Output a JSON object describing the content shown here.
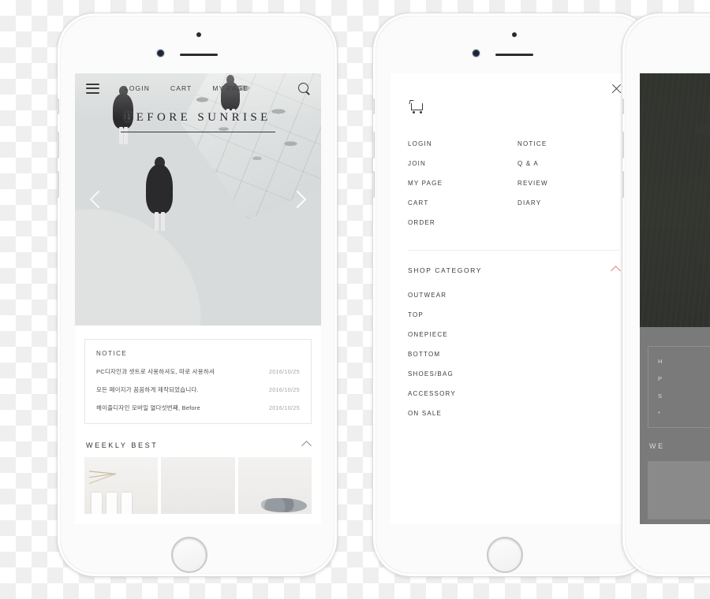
{
  "scene": {
    "background": "transparency-checkerboard",
    "checker_colors": [
      "#ffffff",
      "#efefef"
    ]
  },
  "phone_left": {
    "device": "white smartphone",
    "screen": {
      "topbar": {
        "menu_icon": "hamburger-icon",
        "nav": [
          {
            "label": "LOGIN"
          },
          {
            "label": "CART"
          },
          {
            "label": "MY PAGE"
          }
        ],
        "search_icon": "search-icon"
      },
      "hero": {
        "title": "BEFORE SUNRISE",
        "prev_arrow": "chevron-left-icon",
        "next_arrow": "chevron-right-icon",
        "image_alt": "women on curved concrete staircase, greyscale"
      },
      "notice": {
        "label": "NOTICE",
        "rows": [
          {
            "text": "PC디자인과 셋트로 사용하셔도, 따로 사용하셔",
            "date": "2016/10/25"
          },
          {
            "text": "모든 페이지가 꼼꼼하게 제작되었습니다.",
            "date": "2016/10/25"
          },
          {
            "text": "헤이즐디자인 모바일 열다섯번째, Before",
            "date": "2016/10/25"
          }
        ]
      },
      "weekly_best": {
        "title": "WEEKLY BEST",
        "collapse_icon": "chevron-up-icon",
        "thumbnails": [
          {
            "alt": "cosmetic tubes with dried pampas"
          },
          {
            "alt": "plain light product"
          },
          {
            "alt": "dark marbled fabric"
          }
        ]
      }
    }
  },
  "phone_center": {
    "device": "white smartphone",
    "screen": {
      "close_icon": "close-icon",
      "cart_icon": "shopping-cart-icon",
      "menu_columns": [
        {
          "items": [
            {
              "label": "LOGIN"
            },
            {
              "label": "JOIN"
            },
            {
              "label": "MY PAGE"
            },
            {
              "label": "CART"
            },
            {
              "label": "ORDER"
            }
          ]
        },
        {
          "items": [
            {
              "label": "NOTICE"
            },
            {
              "label": "Q & A"
            },
            {
              "label": "REVIEW"
            },
            {
              "label": "DIARY"
            }
          ]
        }
      ],
      "shop_category": {
        "title": "SHOP CATEGORY",
        "toggle_icon": "chevron-up-icon",
        "toggle_color": "#e4818b",
        "items": [
          {
            "label": "OUTWEAR"
          },
          {
            "label": "TOP"
          },
          {
            "label": "ONEPIECE"
          },
          {
            "label": "BOTTOM"
          },
          {
            "label": "SHOES/BAG"
          },
          {
            "label": "ACCESSORY"
          },
          {
            "label": "ON SALE"
          }
        ]
      }
    }
  },
  "phone_right": {
    "device": "white smartphone (cropped at edge)",
    "screen": {
      "image_alt": "dark green outdoor photo",
      "dimmed": true,
      "notice_glyphs": [
        "H",
        "P",
        "S",
        "*"
      ],
      "weekly_best_partial": "WE"
    }
  }
}
